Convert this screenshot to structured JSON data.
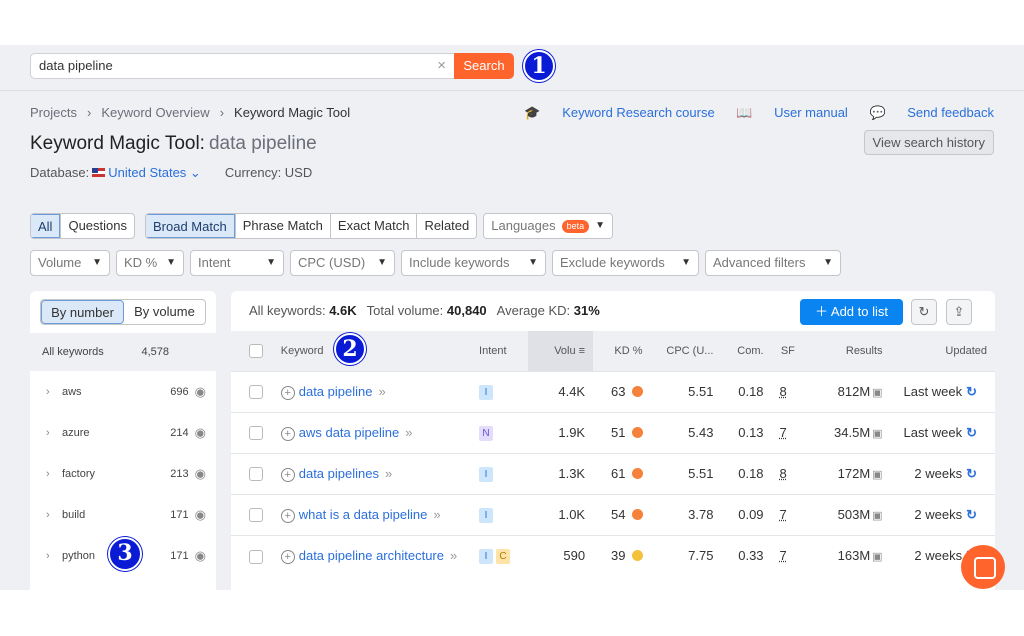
{
  "search": {
    "value": "data pipeline",
    "button": "Search"
  },
  "annotations": [
    "1",
    "2",
    "3"
  ],
  "breadcrumb": [
    "Projects",
    "Keyword Overview",
    "Keyword Magic Tool"
  ],
  "title": {
    "tool": "Keyword Magic Tool:",
    "query": "data pipeline"
  },
  "database": {
    "label": "Database:",
    "value": "United States",
    "currency": "Currency: USD"
  },
  "links": {
    "course": "Keyword Research course",
    "manual": "User manual",
    "feedback": "Send feedback",
    "history": "View search history"
  },
  "filters": {
    "tabs1": [
      "All",
      "Questions"
    ],
    "tabs2": [
      "Broad Match",
      "Phrase Match",
      "Exact Match",
      "Related"
    ],
    "languages": "Languages",
    "beta": "beta",
    "dropdowns": [
      "Volume",
      "KD %",
      "Intent",
      "CPC (USD)",
      "Include keywords",
      "Exclude keywords",
      "Advanced filters"
    ]
  },
  "sidebar": {
    "toggle": [
      "By number",
      "By volume"
    ],
    "all_label": "All keywords",
    "all_count": "4,578",
    "items": [
      {
        "name": "aws",
        "count": "696"
      },
      {
        "name": "azure",
        "count": "214"
      },
      {
        "name": "factory",
        "count": "213"
      },
      {
        "name": "build",
        "count": "171"
      },
      {
        "name": "python",
        "count": "171"
      }
    ]
  },
  "stats": {
    "all_label": "All keywords:",
    "all": "4.6K",
    "vol_label": "Total volume:",
    "vol": "40,840",
    "kd_label": "Average KD:",
    "kd": "31%",
    "add": "Add to list"
  },
  "columns": [
    "Keyword",
    "Intent",
    "Volu",
    "KD %",
    "CPC (U...",
    "Com.",
    "SF",
    "Results",
    "Updated"
  ],
  "rows": [
    {
      "kw": "data pipeline",
      "intent": [
        "I"
      ],
      "vol": "4.4K",
      "kd": "63",
      "kdcolor": "#f5813a",
      "cpc": "5.51",
      "com": "0.18",
      "sf": "8",
      "results": "812M",
      "updated": "Last week"
    },
    {
      "kw": "aws data pipeline",
      "intent": [
        "N"
      ],
      "vol": "1.9K",
      "kd": "51",
      "kdcolor": "#f5813a",
      "cpc": "5.43",
      "com": "0.13",
      "sf": "7",
      "results": "34.5M",
      "updated": "Last week"
    },
    {
      "kw": "data pipelines",
      "intent": [
        "I"
      ],
      "vol": "1.3K",
      "kd": "61",
      "kdcolor": "#f5813a",
      "cpc": "5.51",
      "com": "0.18",
      "sf": "8",
      "results": "172M",
      "updated": "2 weeks"
    },
    {
      "kw": "what is a data pipeline",
      "intent": [
        "I"
      ],
      "vol": "1.0K",
      "kd": "54",
      "kdcolor": "#f5813a",
      "cpc": "3.78",
      "com": "0.09",
      "sf": "7",
      "results": "503M",
      "updated": "2 weeks"
    },
    {
      "kw": "data pipeline architecture",
      "intent": [
        "I",
        "C"
      ],
      "vol": "590",
      "kd": "39",
      "kdcolor": "#f3c23a",
      "cpc": "7.75",
      "com": "0.33",
      "sf": "7",
      "results": "163M",
      "updated": "2 weeks"
    }
  ],
  "colors": {
    "accent": "#ff642d",
    "primary": "#0a84f0",
    "link": "#2a6fdb"
  }
}
